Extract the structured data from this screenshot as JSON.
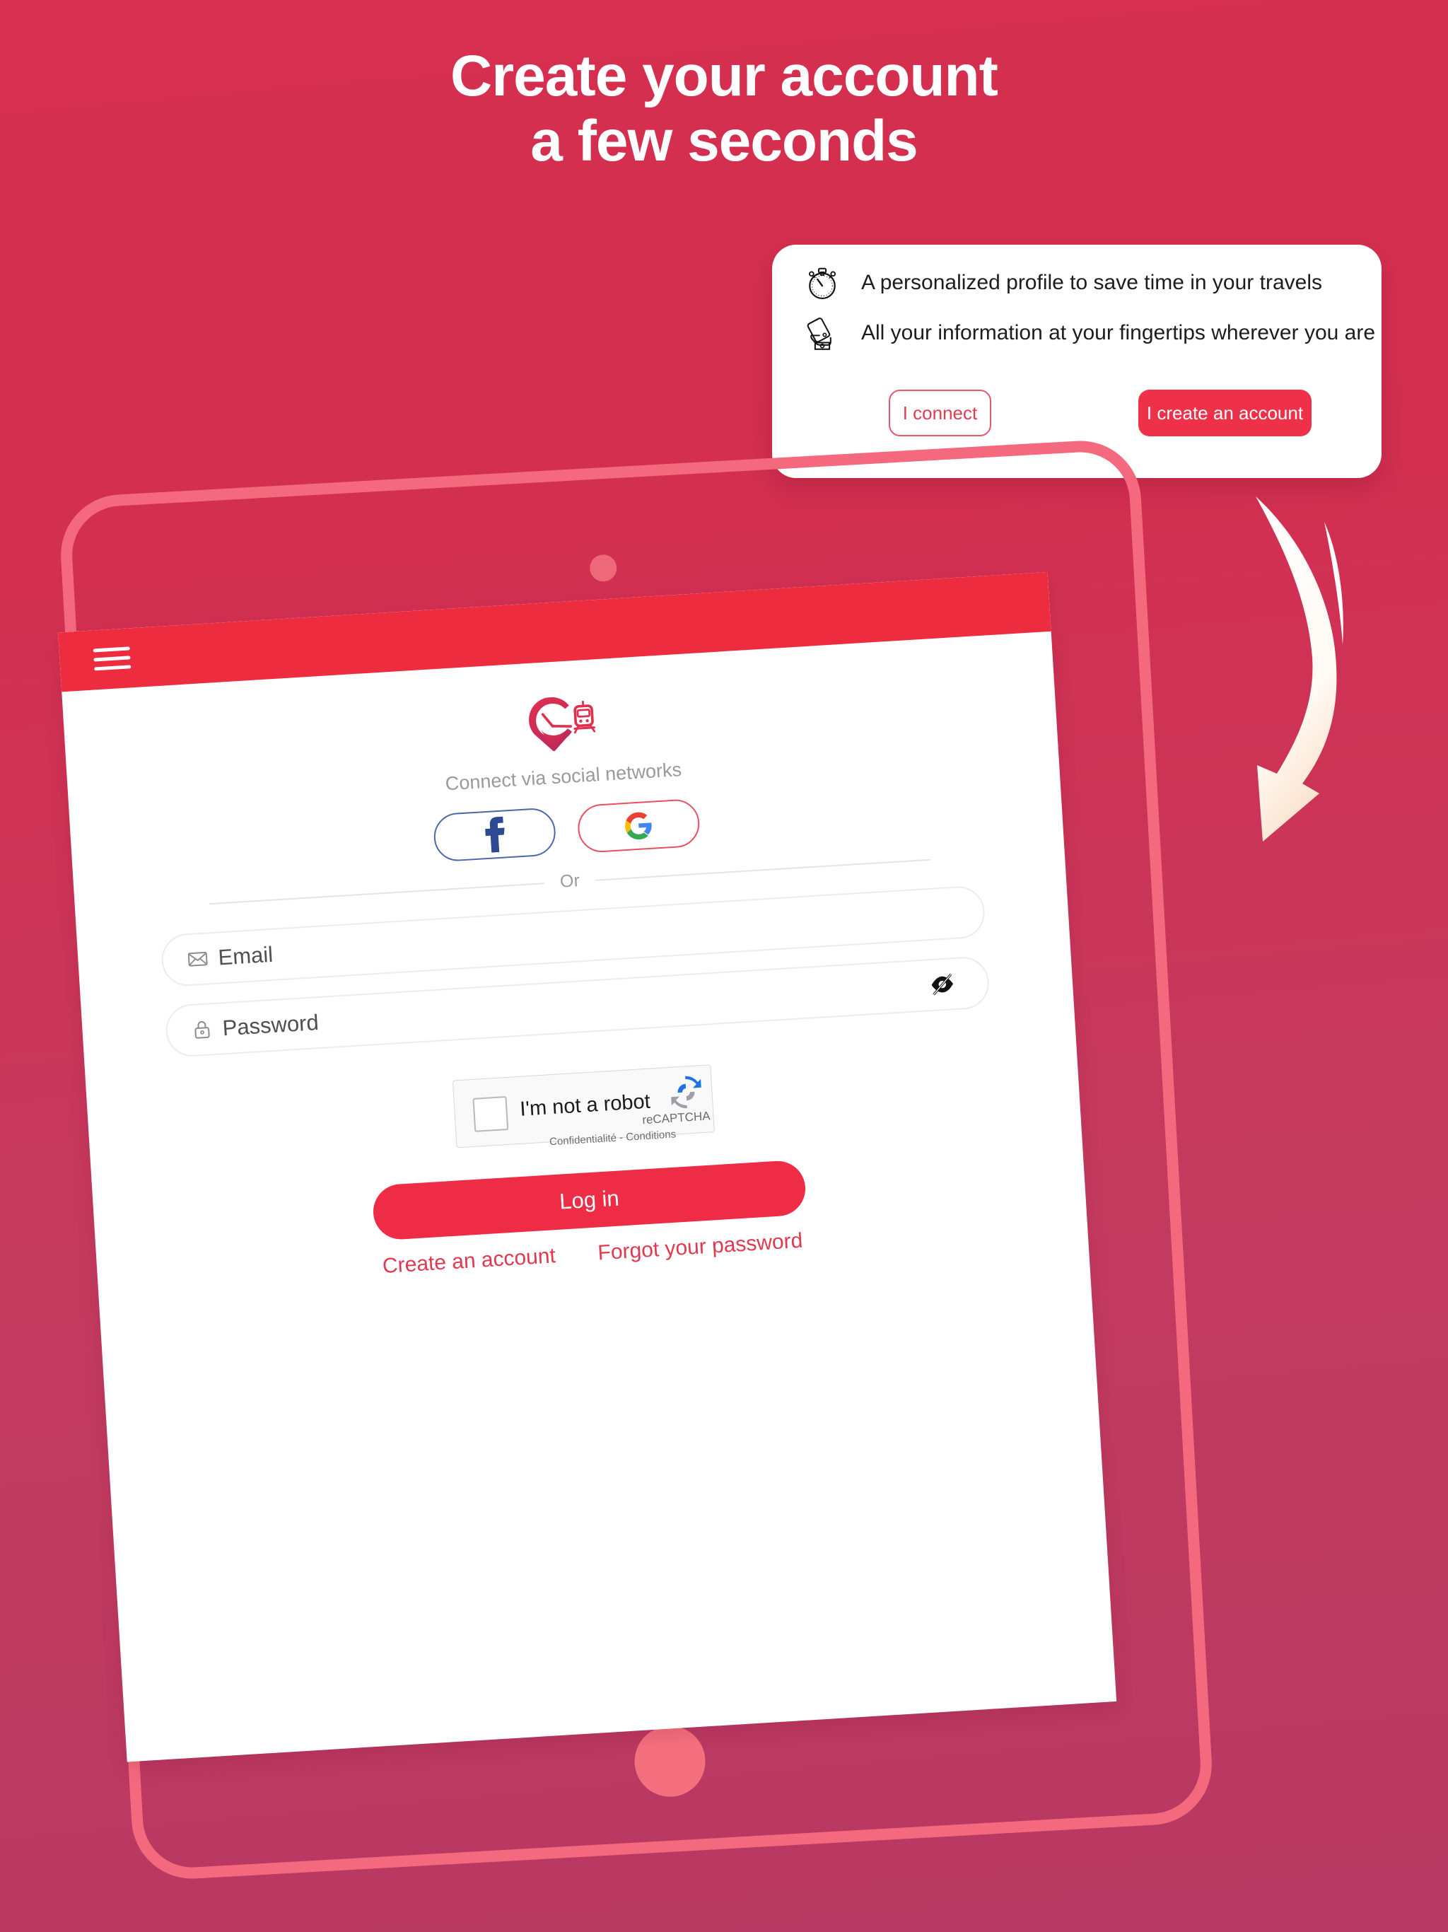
{
  "theme": {
    "bg_top": "#D62F4F",
    "bg_bottom": "#B73963",
    "accent_red": "#EE2C45",
    "appbar_red": "#EE2C3F",
    "tablet_outline": "#F4697D",
    "home_button": "#F4707E"
  },
  "headline": {
    "line1": "Create your account",
    "line2": "a few seconds"
  },
  "promo_card": {
    "benefits": [
      {
        "icon": "stopwatch-icon",
        "text": "A personalized profile to save time in your travels"
      },
      {
        "icon": "hand-holding-phone-icon",
        "text": "All your information at your fingertips wherever you are"
      }
    ],
    "connect_label": "I connect",
    "create_label": "I create an account"
  },
  "tablet": {
    "appbar": {
      "menu_icon": "hamburger-menu-icon"
    },
    "login_screen": {
      "logo_icon": "clock-pin-train-logo",
      "social_label": "Connect via social networks",
      "social_buttons": [
        {
          "name": "facebook-login-button",
          "icon": "facebook-icon"
        },
        {
          "name": "google-login-button",
          "icon": "google-icon"
        }
      ],
      "divider_text": "Or",
      "fields": [
        {
          "name": "email-field",
          "icon": "envelope-icon",
          "label": "Email",
          "placeholder": "Email",
          "value": ""
        },
        {
          "name": "password-field",
          "icon": "lock-icon",
          "label": "Password",
          "placeholder": "Password",
          "value": "",
          "toggle_icon": "eye-off-icon"
        }
      ],
      "captcha": {
        "checkbox_label": "I'm not a robot",
        "brand": "reCAPTCHA",
        "terms": "Confidentialité - Conditions",
        "logo_icon": "recaptcha-icon",
        "checked": false
      },
      "submit_label": "Log in",
      "links": [
        {
          "name": "create-account-link",
          "label": "Create an account"
        },
        {
          "name": "forgot-password-link",
          "label": "Forgot your password"
        }
      ]
    }
  }
}
